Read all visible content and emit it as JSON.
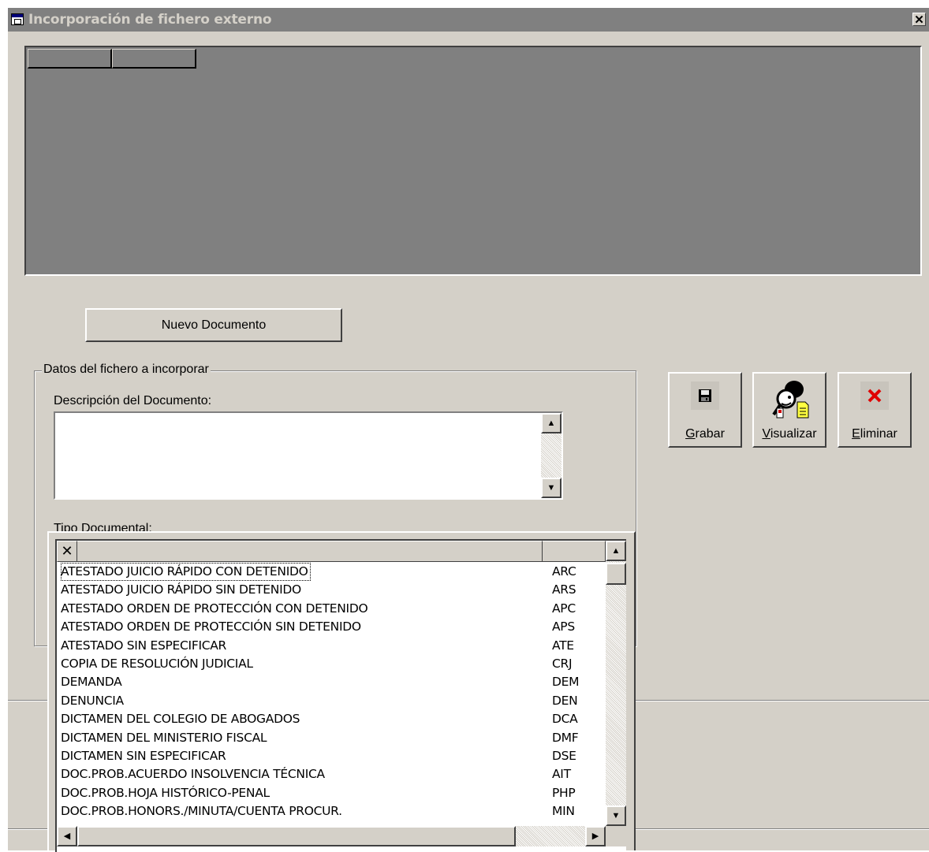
{
  "window": {
    "title": "Incorporación de fichero externo",
    "close_label": "✕"
  },
  "actions": {
    "nuevo_documento": "Nuevo Documento"
  },
  "group": {
    "legend": "Datos del fichero a incorporar",
    "descripcion_label": "Descripción del Documento:",
    "descripcion_value": "",
    "tipo_label": "Tipo Documental:"
  },
  "toolbar": {
    "grabar": {
      "access_key": "G",
      "rest": "rabar",
      "icon": "floppy-disk-icon"
    },
    "visualizar": {
      "access_key": "V",
      "rest": "isualizar",
      "icon": "magnifier-person-icon"
    },
    "eliminar": {
      "access_key": "E",
      "rest": "liminar",
      "icon": "red-x-icon"
    }
  },
  "dropdown": {
    "close_label": "✕",
    "rows": [
      {
        "desc": "ATESTADO JUICIO RÁPIDO CON DETENIDO",
        "code": "ARC"
      },
      {
        "desc": "ATESTADO JUICIO RÁPIDO SIN DETENIDO",
        "code": "ARS"
      },
      {
        "desc": "ATESTADO ORDEN DE PROTECCIÓN CON DETENIDO",
        "code": "APC"
      },
      {
        "desc": "ATESTADO ORDEN DE PROTECCIÓN SIN DETENIDO",
        "code": "APS"
      },
      {
        "desc": "ATESTADO SIN ESPECIFICAR",
        "code": "ATE"
      },
      {
        "desc": "COPIA DE RESOLUCIÓN JUDICIAL",
        "code": "CRJ"
      },
      {
        "desc": "DEMANDA",
        "code": "DEM"
      },
      {
        "desc": "DENUNCIA",
        "code": "DEN"
      },
      {
        "desc": "DICTAMEN DEL COLEGIO DE ABOGADOS",
        "code": "DCA"
      },
      {
        "desc": "DICTAMEN DEL MINISTERIO FISCAL",
        "code": "DMF"
      },
      {
        "desc": "DICTAMEN SIN ESPECIFICAR",
        "code": "DSE"
      },
      {
        "desc": "DOC.PROB.ACUERDO INSOLVENCIA TÉCNICA",
        "code": "AIT"
      },
      {
        "desc": "DOC.PROB.HOJA HISTÓRICO-PENAL",
        "code": "PHP"
      },
      {
        "desc": "DOC.PROB.HONORS./MINUTA/CUENTA PROCUR.",
        "code": "MIN"
      }
    ]
  }
}
